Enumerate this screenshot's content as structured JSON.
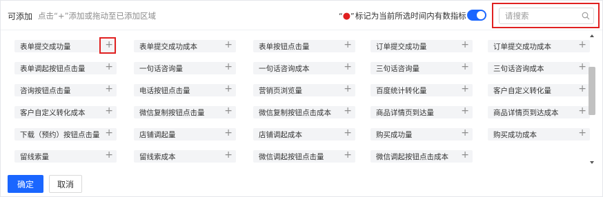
{
  "header": {
    "title": "可添加",
    "hint": "点击“+”添加或拖动至已添加区域",
    "mark_quote_open": "“",
    "mark_dot": "●",
    "mark_quote_close": "”",
    "toggle_label": "标记为当前所选时间内有数指标",
    "toggle_on": true
  },
  "search": {
    "placeholder": "请搜索",
    "value": ""
  },
  "metrics": [
    [
      "表单提交成功量",
      "表单提交成功成本",
      "表单按钮点击量",
      "订单提交成功量",
      "订单提交成功成本"
    ],
    [
      "表单调起按钮点击量",
      "一句话咨询量",
      "一句话咨询成本",
      "三句话咨询量",
      "三句话咨询成本"
    ],
    [
      "咨询按钮点击量",
      "电话按钮点击量",
      "营销页浏览量",
      "百度统计转化量",
      "客户自定义转化量"
    ],
    [
      "客户自定义转化成本",
      "微信复制按钮点击量",
      "微信复制按钮点击成本",
      "商品详情页到达量",
      "商品详情页到达成本"
    ],
    [
      "下载（预约）按钮点击量",
      "店铺调起量",
      "店铺调起成本",
      "购买成功量",
      "购买成功成本"
    ],
    [
      "留线索量",
      "留线索成本",
      "微信调起按钮点击量",
      "微信调起按钮点击成本"
    ]
  ],
  "plus_symbol": "+",
  "buttons": {
    "confirm": "确定",
    "cancel": "取消"
  },
  "colors": {
    "primary": "#1a66ff",
    "highlight": "#e02020",
    "chip_bg": "#f3f4f6"
  }
}
